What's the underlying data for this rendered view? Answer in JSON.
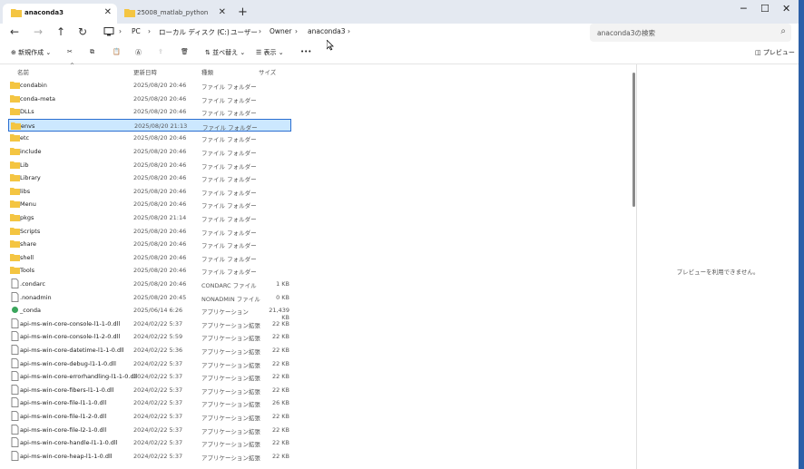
{
  "tabs": [
    {
      "label": "anaconda3",
      "active": true
    },
    {
      "label": "25008_matlab_python",
      "active": false
    }
  ],
  "window_controls": {
    "minimize": "─",
    "maximize": "☐",
    "close": "✕"
  },
  "nav": {
    "back": "←",
    "forward": "→",
    "up": "↑",
    "refresh": "↻"
  },
  "breadcrumb": [
    "PC",
    "ローカル ディスク (C:)",
    "ユーザー",
    "Owner",
    "anaconda3"
  ],
  "search": {
    "placeholder": "anaconda3の検索"
  },
  "toolbar": {
    "new": "新規作成",
    "sort": "並べ替え",
    "view": "表示",
    "more": "•••",
    "preview": "プレビュー"
  },
  "columns": {
    "name": "名前",
    "date": "更新日時",
    "type": "種類",
    "size": "サイズ"
  },
  "files": [
    {
      "name": "condabin",
      "date": "2025/08/20 20:46",
      "type": "ファイル フォルダー",
      "size": "",
      "kind": "folder"
    },
    {
      "name": "conda-meta",
      "date": "2025/08/20 20:46",
      "type": "ファイル フォルダー",
      "size": "",
      "kind": "folder"
    },
    {
      "name": "DLLs",
      "date": "2025/08/20 20:46",
      "type": "ファイル フォルダー",
      "size": "",
      "kind": "folder"
    },
    {
      "name": "envs",
      "date": "2025/08/20 21:13",
      "type": "ファイル フォルダー",
      "size": "",
      "kind": "folder",
      "selected": true
    },
    {
      "name": "etc",
      "date": "2025/08/20 20:46",
      "type": "ファイル フォルダー",
      "size": "",
      "kind": "folder"
    },
    {
      "name": "include",
      "date": "2025/08/20 20:46",
      "type": "ファイル フォルダー",
      "size": "",
      "kind": "folder"
    },
    {
      "name": "Lib",
      "date": "2025/08/20 20:46",
      "type": "ファイル フォルダー",
      "size": "",
      "kind": "folder"
    },
    {
      "name": "Library",
      "date": "2025/08/20 20:46",
      "type": "ファイル フォルダー",
      "size": "",
      "kind": "folder"
    },
    {
      "name": "libs",
      "date": "2025/08/20 20:46",
      "type": "ファイル フォルダー",
      "size": "",
      "kind": "folder"
    },
    {
      "name": "Menu",
      "date": "2025/08/20 20:46",
      "type": "ファイル フォルダー",
      "size": "",
      "kind": "folder"
    },
    {
      "name": "pkgs",
      "date": "2025/08/20 21:14",
      "type": "ファイル フォルダー",
      "size": "",
      "kind": "folder"
    },
    {
      "name": "Scripts",
      "date": "2025/08/20 20:46",
      "type": "ファイル フォルダー",
      "size": "",
      "kind": "folder"
    },
    {
      "name": "share",
      "date": "2025/08/20 20:46",
      "type": "ファイル フォルダー",
      "size": "",
      "kind": "folder"
    },
    {
      "name": "shell",
      "date": "2025/08/20 20:46",
      "type": "ファイル フォルダー",
      "size": "",
      "kind": "folder"
    },
    {
      "name": "Tools",
      "date": "2025/08/20 20:46",
      "type": "ファイル フォルダー",
      "size": "",
      "kind": "folder"
    },
    {
      "name": ".condarc",
      "date": "2025/08/20 20:46",
      "type": "CONDARC ファイル",
      "size": "1 KB",
      "kind": "file"
    },
    {
      "name": ".nonadmin",
      "date": "2025/08/20 20:45",
      "type": "NONADMIN ファイル",
      "size": "0 KB",
      "kind": "file"
    },
    {
      "name": "_conda",
      "date": "2025/06/14 6:26",
      "type": "アプリケーション",
      "size": "21,439 KB",
      "kind": "app"
    },
    {
      "name": "api-ms-win-core-console-l1-1-0.dll",
      "date": "2024/02/22 5:37",
      "type": "アプリケーション拡張",
      "size": "22 KB",
      "kind": "file"
    },
    {
      "name": "api-ms-win-core-console-l1-2-0.dll",
      "date": "2024/02/22 5:59",
      "type": "アプリケーション拡張",
      "size": "22 KB",
      "kind": "file"
    },
    {
      "name": "api-ms-win-core-datetime-l1-1-0.dll",
      "date": "2024/02/22 5:36",
      "type": "アプリケーション拡張",
      "size": "22 KB",
      "kind": "file"
    },
    {
      "name": "api-ms-win-core-debug-l1-1-0.dll",
      "date": "2024/02/22 5:37",
      "type": "アプリケーション拡張",
      "size": "22 KB",
      "kind": "file"
    },
    {
      "name": "api-ms-win-core-errorhandling-l1-1-0.dll",
      "date": "2024/02/22 5:37",
      "type": "アプリケーション拡張",
      "size": "22 KB",
      "kind": "file"
    },
    {
      "name": "api-ms-win-core-fibers-l1-1-0.dll",
      "date": "2024/02/22 5:37",
      "type": "アプリケーション拡張",
      "size": "22 KB",
      "kind": "file"
    },
    {
      "name": "api-ms-win-core-file-l1-1-0.dll",
      "date": "2024/02/22 5:37",
      "type": "アプリケーション拡張",
      "size": "26 KB",
      "kind": "file"
    },
    {
      "name": "api-ms-win-core-file-l1-2-0.dll",
      "date": "2024/02/22 5:37",
      "type": "アプリケーション拡張",
      "size": "22 KB",
      "kind": "file"
    },
    {
      "name": "api-ms-win-core-file-l2-1-0.dll",
      "date": "2024/02/22 5:37",
      "type": "アプリケーション拡張",
      "size": "22 KB",
      "kind": "file"
    },
    {
      "name": "api-ms-win-core-handle-l1-1-0.dll",
      "date": "2024/02/22 5:37",
      "type": "アプリケーション拡張",
      "size": "22 KB",
      "kind": "file"
    },
    {
      "name": "api-ms-win-core-heap-l1-1-0.dll",
      "date": "2024/02/22 5:37",
      "type": "アプリケーション拡張",
      "size": "22 KB",
      "kind": "file"
    }
  ],
  "preview_message": "プレビューを利用できません。",
  "colors": {
    "folder": "#f4c542",
    "selection": "#cce8ff",
    "selection_border": "#2b6fd1"
  }
}
